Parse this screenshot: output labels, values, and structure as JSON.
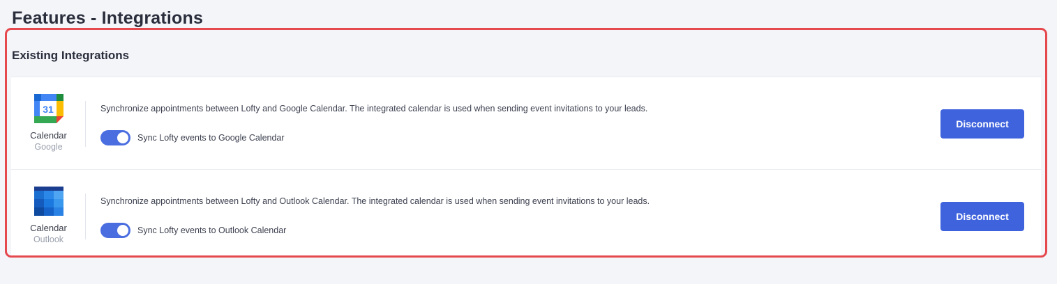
{
  "page": {
    "title": "Features - Integrations"
  },
  "section": {
    "title": "Existing Integrations"
  },
  "integrations": [
    {
      "icon": "google-calendar-icon",
      "name": "Calendar",
      "provider": "Google",
      "description": "Synchronize appointments between Lofty and Google Calendar. The integrated calendar is used when sending event invitations to your leads.",
      "toggle_label": "Sync Lofty events to Google Calendar",
      "toggle_on": true,
      "button_label": "Disconnect"
    },
    {
      "icon": "outlook-calendar-icon",
      "name": "Calendar",
      "provider": "Outlook",
      "description": "Synchronize appointments between Lofty and Outlook Calendar. The integrated calendar is used when sending event invitations to your leads.",
      "toggle_label": "Sync Lofty events to Outlook Calendar",
      "toggle_on": true,
      "button_label": "Disconnect"
    }
  ],
  "google_icon": {
    "day": "31"
  },
  "colors": {
    "accent": "#3f63dd",
    "toggle_on": "#4a6ee0",
    "highlight_border": "#e5484d"
  }
}
